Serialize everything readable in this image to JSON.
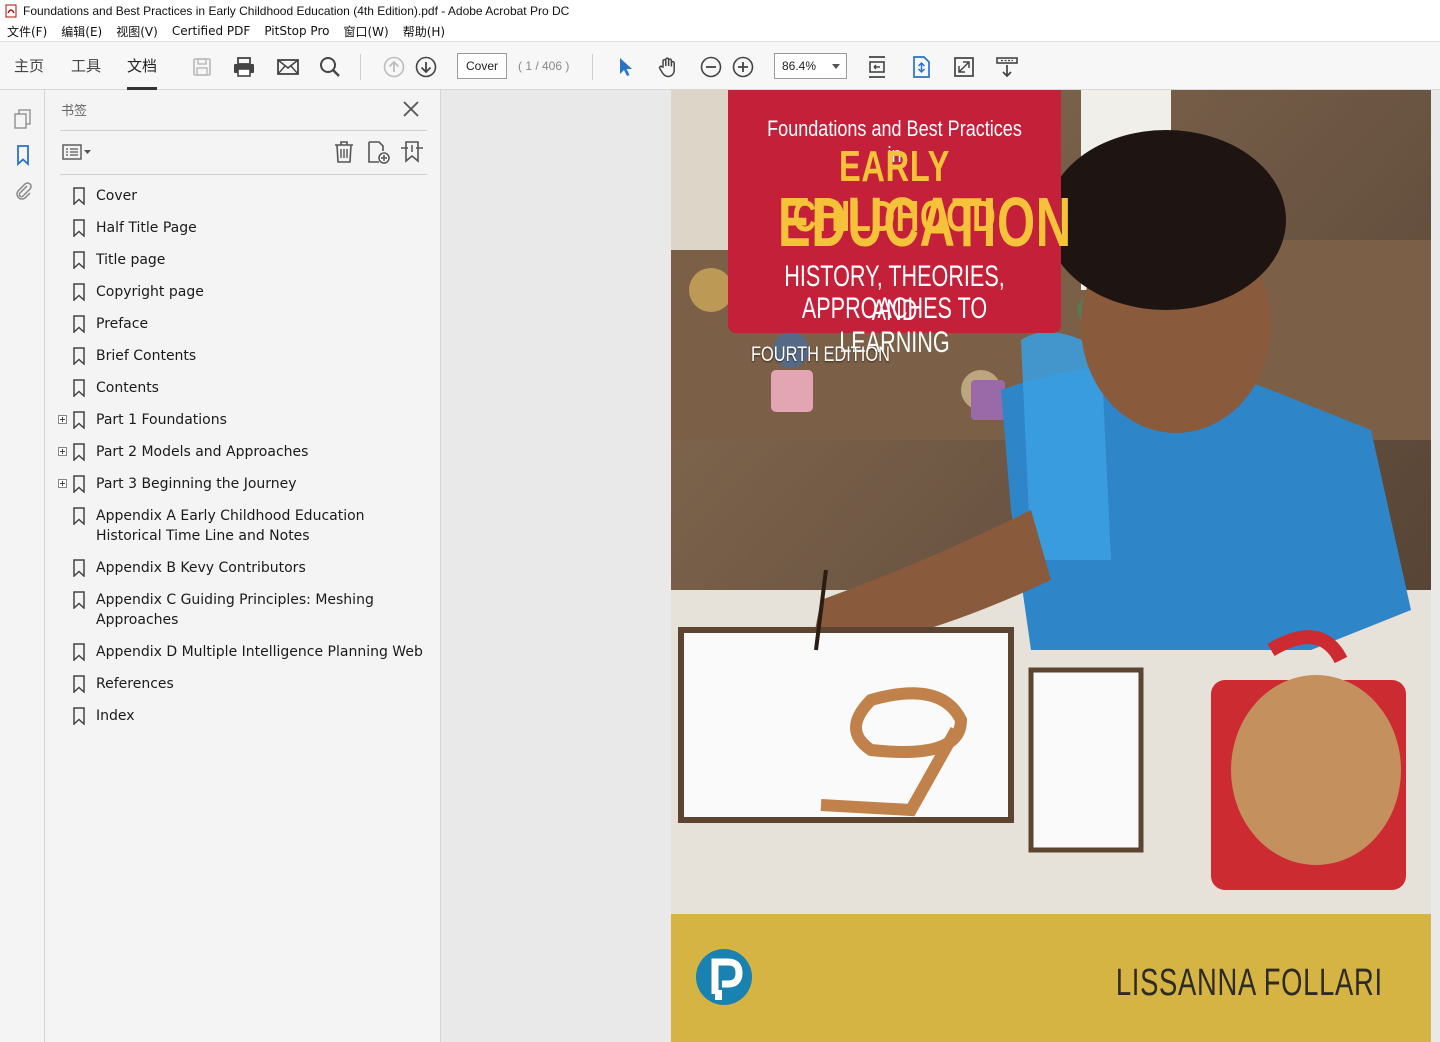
{
  "window": {
    "title": "Foundations and Best Practices in Early Childhood Education (4th Edition).pdf - Adobe Acrobat Pro DC"
  },
  "menu": [
    "文件(F)",
    "编辑(E)",
    "视图(V)",
    "Certified PDF",
    "PitStop Pro",
    "窗口(W)",
    "帮助(H)"
  ],
  "toolbar": {
    "tabs": {
      "home": "主页",
      "tools": "工具",
      "document": "文档"
    },
    "active_tab": "文档",
    "page_value": "Cover",
    "page_count": "( 1 / 406 )",
    "zoom_value": "86.4%",
    "accent_color": "#2a73c9"
  },
  "panel": {
    "title": "书签",
    "bookmarks": [
      {
        "label": "Cover",
        "expandable": false
      },
      {
        "label": "Half Title Page",
        "expandable": false
      },
      {
        "label": "Title page",
        "expandable": false
      },
      {
        "label": "Copyright page",
        "expandable": false
      },
      {
        "label": "Preface",
        "expandable": false
      },
      {
        "label": "Brief Contents",
        "expandable": false
      },
      {
        "label": "Contents",
        "expandable": false
      },
      {
        "label": "Part 1 Foundations",
        "expandable": true
      },
      {
        "label": "Part 2 Models and Approaches",
        "expandable": true
      },
      {
        "label": "Part 3 Beginning the Journey",
        "expandable": true
      },
      {
        "label": "Appendix A Early Childhood Education Historical Time Line and Notes",
        "expandable": false
      },
      {
        "label": "Appendix B Kevy Contributors",
        "expandable": false
      },
      {
        "label": "Appendix C Guiding Principles: Meshing Approaches",
        "expandable": false
      },
      {
        "label": "Appendix D Multiple Intelligence Planning Web",
        "expandable": false
      },
      {
        "label": "References",
        "expandable": false
      },
      {
        "label": "Index",
        "expandable": false
      }
    ]
  },
  "cover": {
    "line1": "Foundations and Best Practices in",
    "line2": "EARLY CHILDHOOD",
    "line3": "EDUCATION",
    "line4": "HISTORY, THEORIES, AND",
    "line5": "APPROACHES TO LEARNING",
    "edition": "FOURTH EDITION",
    "author": "LISSANNA FOLLARI",
    "title_box_color": "#c5203a",
    "title_accent_color": "#f6c23a",
    "band_color": "#d5b444"
  }
}
